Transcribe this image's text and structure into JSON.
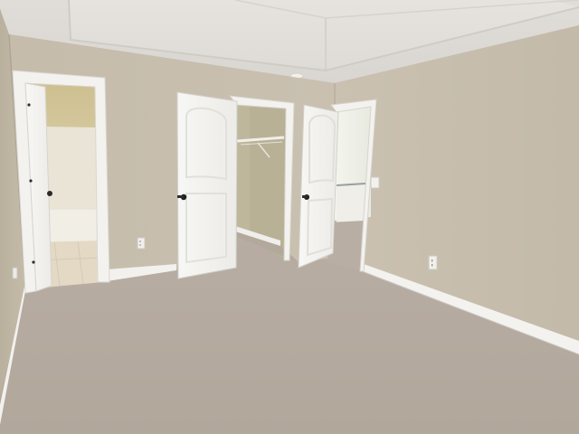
{
  "scene": {
    "subject": "empty-bedroom-interior",
    "colors": {
      "wall": "#c8bfaf",
      "wall_right": "#c9c0b0",
      "ceiling": "#e4e1dc",
      "carpet": "#b7aba0",
      "door": "#f4f4f1",
      "trim": "#f2f1ee",
      "closet_wall": "#bfb9a0",
      "bath_wall": "#d7cca4",
      "tile": "#e6dcc7"
    },
    "icons": {
      "knob": "door-knob-icon",
      "outlet": "outlet-icon",
      "light_switch": "light-switch-icon",
      "smoke_detector": "smoke-detector-icon"
    }
  }
}
